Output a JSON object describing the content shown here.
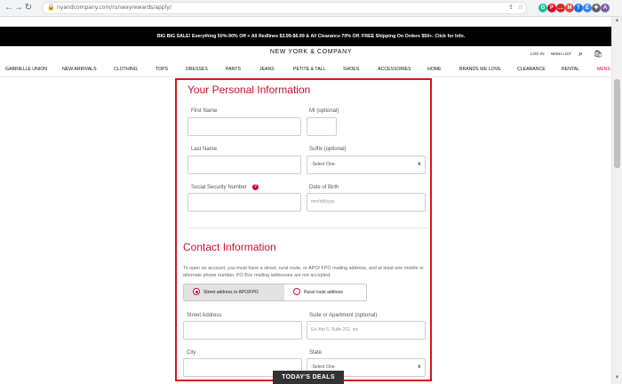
{
  "browser": {
    "url": "nyandcompany.com/runwayrewards/apply/",
    "extension_icons": [
      {
        "name": "grammarly-icon",
        "letter": "G",
        "color": "#15c39a"
      },
      {
        "name": "pinterest-icon",
        "letter": "P",
        "color": "#e60023"
      },
      {
        "name": "lastpass-icon",
        "letter": "…",
        "color": "#d32d27"
      },
      {
        "name": "gmail-icon",
        "letter": "M",
        "color": "#ea4335"
      },
      {
        "name": "translate-icon",
        "letter": "T",
        "color": "#1a73e8"
      },
      {
        "name": "extension-icon",
        "letter": "E",
        "color": "#4285f4"
      },
      {
        "name": "puzzle-icon",
        "letter": "✚",
        "color": "#5f6368"
      },
      {
        "name": "profile-icon",
        "letter": "A",
        "color": "#7b5ea7"
      }
    ]
  },
  "promo": {
    "text": "BIG BIG SALE! Everything 50%-90% Off + All Redlines $3.99-$6.99 & All Clearance 70% Off. FREE Shipping On Orders $50+. Click for Info."
  },
  "header": {
    "brand": "NEW YORK & COMPANY",
    "login": "LOG IN",
    "wishlist": "WISH LIST"
  },
  "nav": {
    "items": [
      "GABRIELLE UNION",
      "NEW ARRIVALS",
      "CLOTHING",
      "TOPS",
      "DRESSES",
      "PANTS",
      "JEANS",
      "PETITE & TALL",
      "SHOES",
      "ACCESSORIES",
      "HOME",
      "BRANDS WE LOVE",
      "CLEARANCE",
      "RENTAL",
      "MENS"
    ]
  },
  "personal": {
    "title": "Your Personal Information",
    "first_name_label": "First Name",
    "mi_label": "MI (optional)",
    "last_name_label": "Last Name",
    "suffix_label": "Suffix (optional)",
    "suffix_value": "-Select One-",
    "ssn_label": "Social Security Number",
    "dob_label": "Date of Birth",
    "dob_placeholder": "mm/dd/yyyy"
  },
  "contact": {
    "title": "Contact Information",
    "instructions": "To open an account, you must have a street, rural route, or APO/ FPO mailing address, and at least one mobile or alternate phone number. PO Box mailing addresses are not accepted.",
    "option_street": "Street address or APO/FPO",
    "option_rural": "Rural route address",
    "street_label": "Street Address",
    "suite_label": "Suite or Apartment (optional)",
    "suite_placeholder": "Ex: Apt 5, Suite 202, etc",
    "city_label": "City",
    "state_label": "State",
    "state_value": "-Select One-"
  },
  "deals": {
    "label": "TODAY'S DEALS"
  },
  "colors": {
    "accent": "#c8102e",
    "frame": "#d5141c",
    "banner": "#000000"
  }
}
